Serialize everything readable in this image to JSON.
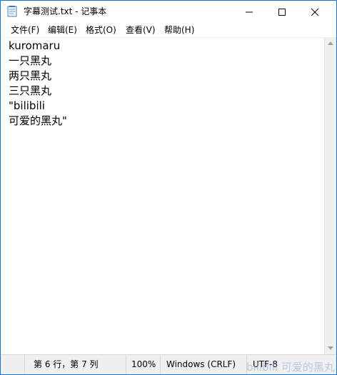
{
  "window": {
    "title": "字幕测试.txt - 记事本"
  },
  "menu": {
    "file": "文件(F)",
    "edit": "编辑(E)",
    "format": "格式(O)",
    "view": "查看(V)",
    "help": "帮助(H)"
  },
  "editor": {
    "lines": [
      "kuromaru",
      "一只黑丸",
      "两只黑丸",
      "三只黑丸",
      "\"bilibili",
      "可爱的黑丸\""
    ]
  },
  "status": {
    "position": "第 6 行，第 7 列",
    "zoom": "100%",
    "line_ending": "Windows (CRLF)",
    "encoding": "UTF-8"
  },
  "watermark": {
    "text": "bilibili 可爱的黑丸"
  },
  "colors": {
    "window_border": "#1a73c9",
    "statusbar_bg": "#f0f0f0"
  }
}
